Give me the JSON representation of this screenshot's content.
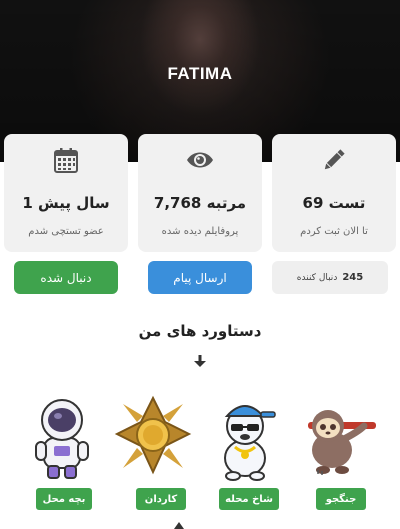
{
  "profile": {
    "name": "FATIMA"
  },
  "stats": [
    {
      "value": "69 تست",
      "caption": "تا الان ثبت کردم",
      "icon": "pencil-icon"
    },
    {
      "value": "7,768 مرتبه",
      "caption": "پروفایلم دیده شده",
      "icon": "eye-icon"
    },
    {
      "value": "1 سال پیش",
      "caption": "عضو تستچی شدم",
      "icon": "calendar-icon"
    }
  ],
  "actions": {
    "followers_count": "245",
    "followers_label": "دنبال کننده",
    "message_label": "ارسال پیام",
    "following_label": "دنبال شده"
  },
  "achievements": {
    "title": "دستاورد های من",
    "items": [
      {
        "label": "جنگجو",
        "icon": "sloth-icon"
      },
      {
        "label": "شاخ محله",
        "icon": "cool-bear-icon"
      },
      {
        "label": "کاردان",
        "icon": "gold-medal-icon"
      },
      {
        "label": "بچه محل",
        "icon": "astronaut-icon"
      }
    ]
  },
  "colors": {
    "green": "#3fa34d",
    "blue": "#3a8fdb",
    "card": "#f1f1f1"
  }
}
